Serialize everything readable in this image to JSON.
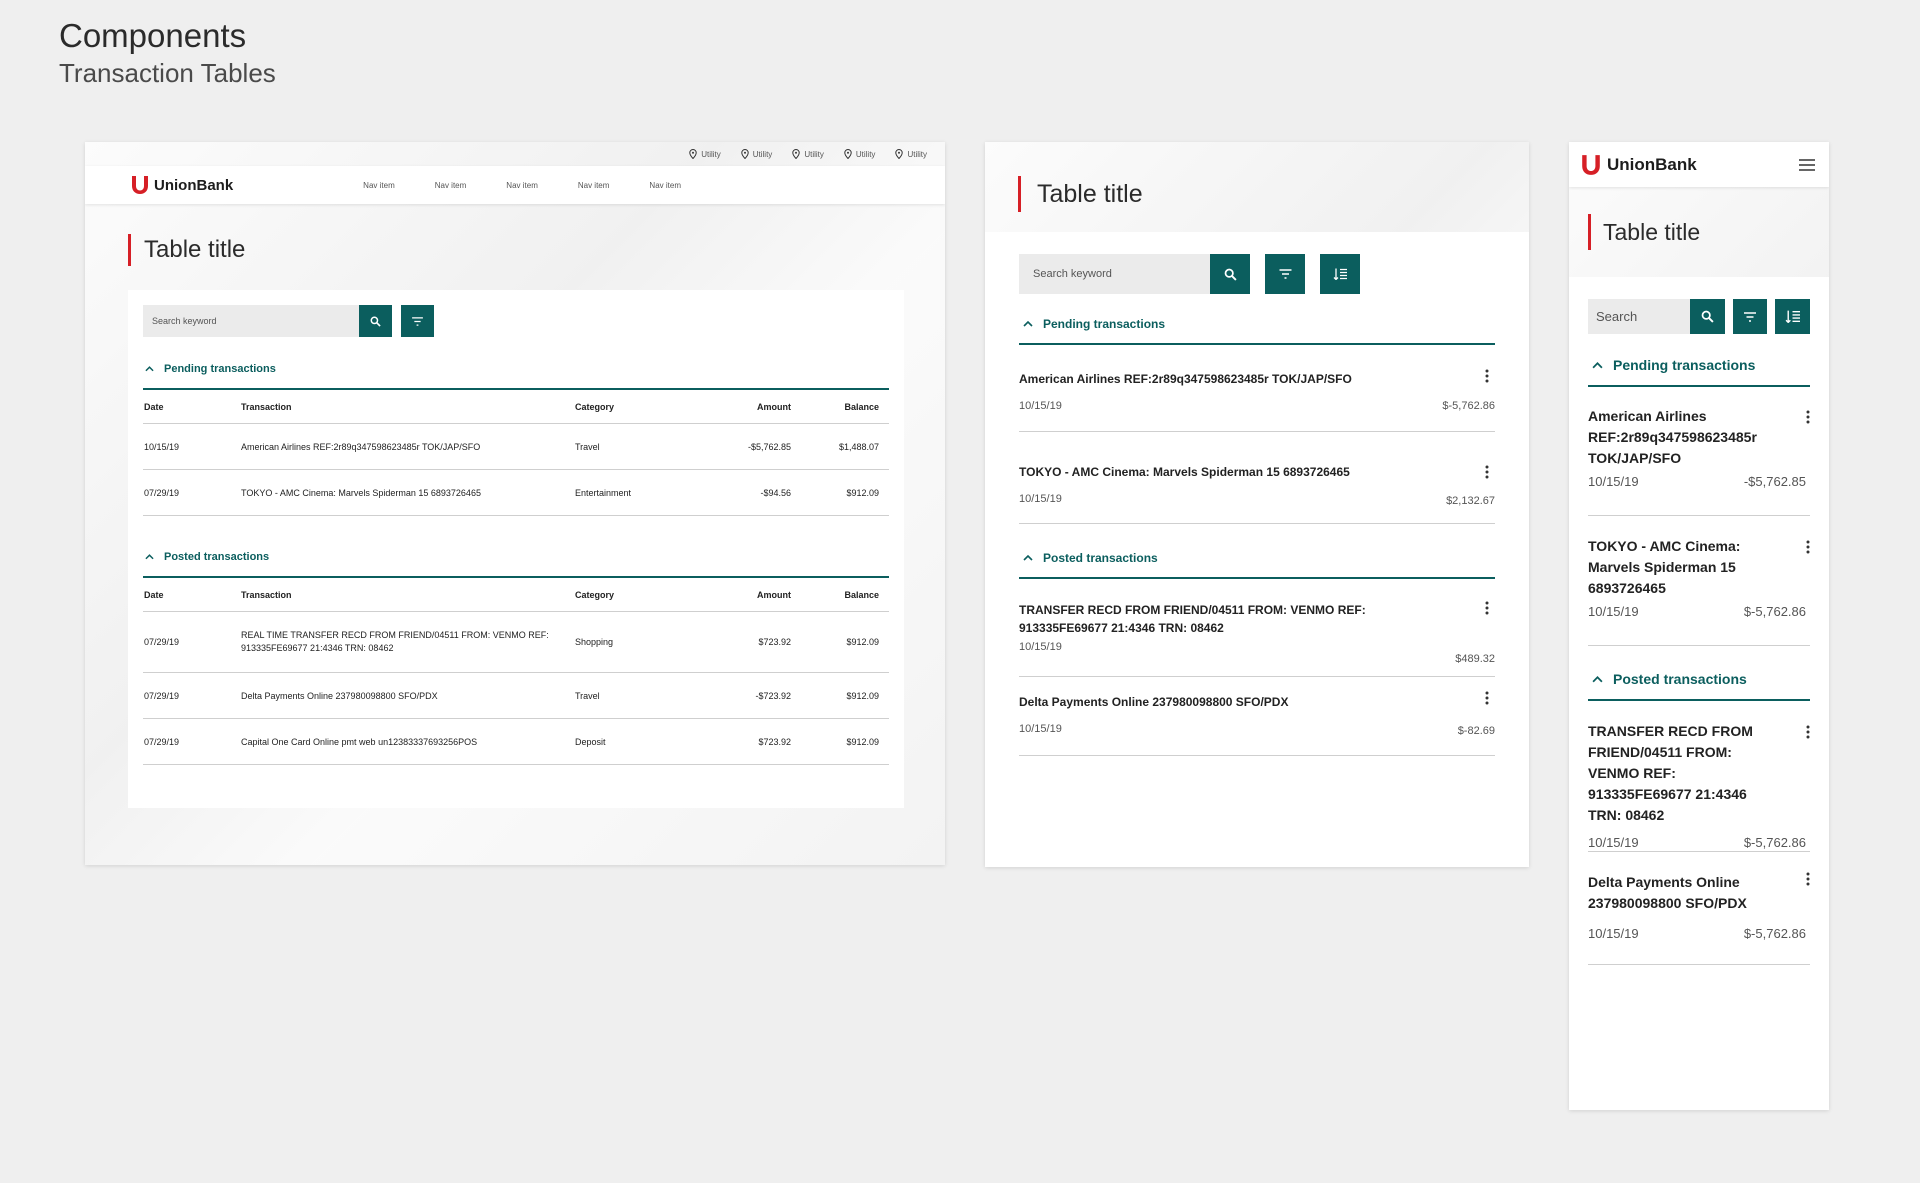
{
  "heading": {
    "title": "Components",
    "subtitle": "Transaction Tables"
  },
  "brand": {
    "name": "UnionBank",
    "accent": "#d61f26",
    "teal": "#0b5e5e"
  },
  "desktop": {
    "utility_items": [
      "Utility",
      "Utility",
      "Utility",
      "Utility",
      "Utility"
    ],
    "nav_items": [
      "Nav item",
      "Nav item",
      "Nav item",
      "Nav item",
      "Nav item"
    ],
    "table_title": "Table title",
    "search_placeholder": "Search keyword",
    "columns": {
      "date": "Date",
      "transaction": "Transaction",
      "category": "Category",
      "amount": "Amount",
      "balance": "Balance"
    },
    "pending": {
      "label": "Pending transactions",
      "rows": [
        {
          "date": "10/15/19",
          "transaction": "American Airlines REF:2r89q347598623485r TOK/JAP/SFO",
          "category": "Travel",
          "amount": "-$5,762.85",
          "balance": "$1,488.07"
        },
        {
          "date": "07/29/19",
          "transaction": "TOKYO - AMC Cinema: Marvels Spiderman 15 6893726465",
          "category": "Entertainment",
          "amount": "-$94.56",
          "balance": "$912.09"
        }
      ]
    },
    "posted": {
      "label": "Posted transactions",
      "rows": [
        {
          "date": "07/29/19",
          "transaction": "REAL TIME TRANSFER RECD FROM FRIEND/04511 FROM: VENMO REF: 913335FE69677 21:4346 TRN: 08462",
          "category": "Shopping",
          "amount": "$723.92",
          "balance": "$912.09"
        },
        {
          "date": "07/29/19",
          "transaction": "Delta Payments Online 237980098800 SFO/PDX",
          "category": "Travel",
          "amount": "-$723.92",
          "balance": "$912.09"
        },
        {
          "date": "07/29/19",
          "transaction": "Capital One Card Online pmt web un12383337693256POS",
          "category": "Deposit",
          "amount": "$723.92",
          "balance": "$912.09"
        }
      ]
    }
  },
  "tablet": {
    "table_title": "Table title",
    "search_placeholder": "Search keyword",
    "pending": {
      "label": "Pending transactions",
      "items": [
        {
          "name": "American Airlines REF:2r89q347598623485r TOK/JAP/SFO",
          "date": "10/15/19",
          "amount": "$-5,762.86"
        },
        {
          "name": "TOKYO - AMC Cinema: Marvels Spiderman 15 6893726465",
          "date": "10/15/19",
          "amount": "$2,132.67"
        }
      ]
    },
    "posted": {
      "label": "Posted transactions",
      "items": [
        {
          "name": "TRANSFER RECD FROM FRIEND/04511 FROM: VENMO REF: 913335FE69677 21:4346 TRN: 08462",
          "date": "10/15/19",
          "amount": "$489.32"
        },
        {
          "name": "Delta Payments Online 237980098800 SFO/PDX",
          "date": "10/15/19",
          "amount": "$-82.69"
        }
      ]
    }
  },
  "mobile": {
    "table_title": "Table title",
    "search_placeholder": "Search",
    "pending": {
      "label": "Pending transactions",
      "items": [
        {
          "name": "American Airlines REF:2r89q347598623485r TOK/JAP/SFO",
          "date": "10/15/19",
          "amount": "-$5,762.85"
        },
        {
          "name": "TOKYO - AMC Cinema: Marvels Spiderman 15 6893726465",
          "date": "10/15/19",
          "amount": "$-5,762.86"
        }
      ]
    },
    "posted": {
      "label": "Posted transactions",
      "items": [
        {
          "name": "TRANSFER RECD FROM FRIEND/04511 FROM: VENMO REF: 913335FE69677 21:4346 TRN: 08462",
          "date": "10/15/19",
          "amount": "$-5,762.86"
        },
        {
          "name": "Delta Payments Online 237980098800 SFO/PDX",
          "date": "10/15/19",
          "amount": "$-5,762.86"
        }
      ]
    }
  }
}
